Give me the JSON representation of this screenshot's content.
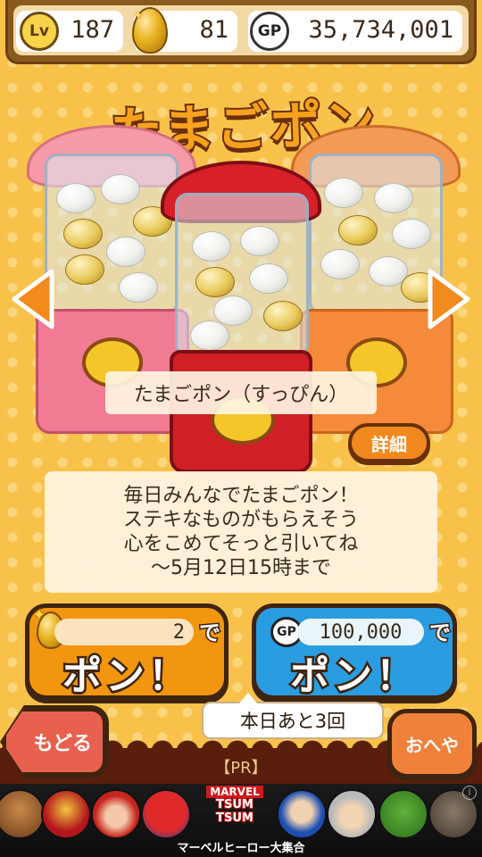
{
  "status": {
    "level_badge": "Lv",
    "level": "187",
    "eggs": "81",
    "gp_badge": "GP",
    "gp": "35,734,001"
  },
  "title": "たまごポン",
  "machine_name": "たまごポン（すっぴん）",
  "detail_label": "詳細",
  "message_lines": [
    "毎日みんなでたまごポン！",
    "ステキなものがもらえそう",
    "心をこめてそっと引いてね",
    "〜5月12日15時まで"
  ],
  "pon_egg": {
    "cost": "2",
    "de": "で",
    "label": "ポン！"
  },
  "pon_gp": {
    "gp_badge": "GP",
    "cost": "100,000",
    "de": "で",
    "label": "ポン！"
  },
  "remaining": "本日あと3回",
  "back_label": "もどる",
  "room_label": "おへや",
  "pr_label": "【PR】",
  "ad": {
    "brand": "MARVEL",
    "logo_text": "TSUM TSUM",
    "caption": "マーベルヒーロー大集合",
    "info": "i"
  },
  "colors": {
    "background": "#f8c24a",
    "egg_button": "#f3960f",
    "gp_button": "#2a9ce0",
    "back_button": "#e8614e",
    "room_button": "#f0813a",
    "outline": "#3f2410"
  }
}
